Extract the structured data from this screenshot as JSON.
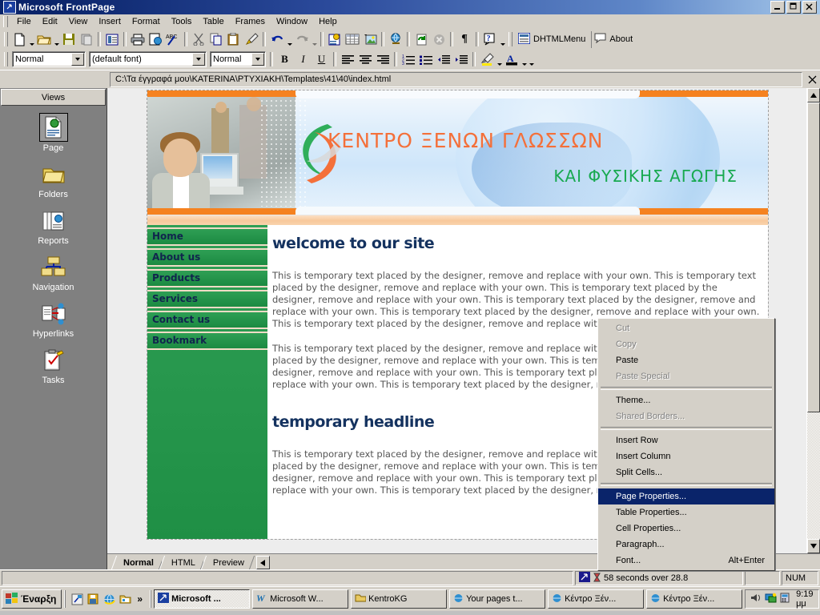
{
  "window": {
    "title": "Microsoft FrontPage",
    "icon": "frontpage-icon",
    "minimize": "_",
    "restore": "❐",
    "close": "✕"
  },
  "menubar": {
    "items": [
      "File",
      "Edit",
      "View",
      "Insert",
      "Format",
      "Tools",
      "Table",
      "Frames",
      "Window",
      "Help"
    ]
  },
  "standard_toolbar": {
    "buttons": [
      {
        "name": "new-page-button",
        "icon": "new-page-icon"
      },
      {
        "name": "open-button",
        "icon": "open-folder-icon"
      },
      {
        "name": "save-button",
        "icon": "save-disk-icon"
      },
      {
        "name": "publish-web-button",
        "icon": "publish-web-icon"
      },
      {
        "name": "folder-list-button",
        "icon": "folder-list-icon"
      },
      {
        "name": "print-button",
        "icon": "printer-icon"
      },
      {
        "name": "print-preview-button",
        "icon": "print-preview-icon"
      },
      {
        "name": "spelling-button",
        "icon": "spelling-abc-icon"
      },
      {
        "name": "cut-button",
        "icon": "scissors-icon"
      },
      {
        "name": "copy-button",
        "icon": "copy-icon"
      },
      {
        "name": "paste-button",
        "icon": "paste-clipboard-icon"
      },
      {
        "name": "format-painter-button",
        "icon": "paintbrush-icon"
      },
      {
        "name": "undo-button",
        "icon": "undo-arrow-icon"
      },
      {
        "name": "redo-button",
        "icon": "redo-arrow-icon"
      },
      {
        "name": "web-component-button",
        "icon": "web-component-icon"
      },
      {
        "name": "insert-table-button",
        "icon": "table-grid-icon"
      },
      {
        "name": "insert-picture-button",
        "icon": "picture-icon"
      },
      {
        "name": "hyperlink-button",
        "icon": "globe-link-icon"
      },
      {
        "name": "refresh-button",
        "icon": "refresh-icon"
      },
      {
        "name": "stop-button",
        "icon": "stop-icon"
      },
      {
        "name": "show-all-button",
        "icon": "pilcrow-icon"
      },
      {
        "name": "help-button",
        "icon": "help-question-icon"
      }
    ],
    "dhtml_menu_label": "DHTMLMenu",
    "about_label": "About"
  },
  "formatting_toolbar": {
    "style_value": "Normal",
    "font_value": "(default font)",
    "size_value": "Normal",
    "bold": "B",
    "italic": "I",
    "underline": "U",
    "buttons": [
      {
        "name": "align-left-button",
        "icon": "align-left-icon"
      },
      {
        "name": "align-center-button",
        "icon": "align-center-icon"
      },
      {
        "name": "align-right-button",
        "icon": "align-right-icon"
      },
      {
        "name": "numbered-list-button",
        "icon": "numbered-list-icon"
      },
      {
        "name": "bulleted-list-button",
        "icon": "bulleted-list-icon"
      },
      {
        "name": "decrease-indent-button",
        "icon": "decrease-indent-icon"
      },
      {
        "name": "increase-indent-button",
        "icon": "increase-indent-icon"
      },
      {
        "name": "highlight-button",
        "icon": "highlighter-icon"
      },
      {
        "name": "font-color-button",
        "icon": "font-color-icon"
      }
    ]
  },
  "address_bar": {
    "path": "C:\\Τα έγγραφά μου\\KATERINA\\PTYXIAKH\\Templates\\41\\40\\index.html",
    "close": "✕"
  },
  "views_pane": {
    "header": "Views",
    "items": [
      {
        "label": "Page",
        "icon": "page-view-icon",
        "selected": true
      },
      {
        "label": "Folders",
        "icon": "folders-view-icon",
        "selected": false
      },
      {
        "label": "Reports",
        "icon": "reports-view-icon",
        "selected": false
      },
      {
        "label": "Navigation",
        "icon": "navigation-view-icon",
        "selected": false
      },
      {
        "label": "Hyperlinks",
        "icon": "hyperlinks-view-icon",
        "selected": false
      },
      {
        "label": "Tasks",
        "icon": "tasks-view-icon",
        "selected": false
      }
    ]
  },
  "page": {
    "banner": {
      "title": "ΚΕΝΤΡΟ ΞΕΝΩΝ ΓΛΩΣΣΩΝ",
      "subtitle": "ΚΑΙ ΦΥΣΙΚΗΣ ΑΓΩΓΗΣ",
      "title_color": "#f4703a",
      "subtitle_color": "#18a950"
    },
    "nav": {
      "items": [
        "Home",
        "About us",
        "Products",
        "Services",
        "Contact us",
        "Bookmark"
      ],
      "bg_color": "#2a9a4f",
      "text_color": "#10254d"
    },
    "headline1": "welcome to our site",
    "headline2": "temporary headline",
    "paragraph1": "This is temporary text placed by the designer, remove and replace with your own. This is temporary text placed by the designer, remove and replace with your own. This is temporary text placed by the designer, remove and replace with your own. This is temporary text placed by the designer, remove and replace with your own. This is temporary text placed by the designer, remove and replace with your own. This is temporary text placed by the designer, remove and replace with your own.",
    "paragraph2": "This is temporary text placed by the designer, remove and replace with your own. This is temporary text placed by the designer, remove and replace with your own. This is temporary text placed by the designer, remove and replace with your own. This is temporary text placed by the designer, remove and replace with your own. This is temporary text placed by the designer, remove and replace with your own.",
    "paragraph3": "This is temporary text placed by the designer, remove and replace with your own. This is temporary text placed by the designer, remove and replace with your own. This is temporary text placed by the designer, remove and replace with your own. This is temporary text placed by the designer, remove and replace with your own. This is temporary text placed by the designer, remove and replace with your own."
  },
  "context_menu": {
    "items": [
      {
        "label": "Cut",
        "state": "disabled",
        "shortcut": ""
      },
      {
        "label": "Copy",
        "state": "disabled",
        "shortcut": ""
      },
      {
        "label": "Paste",
        "state": "normal",
        "shortcut": ""
      },
      {
        "label": "Paste Special",
        "state": "disabled",
        "shortcut": ""
      },
      {
        "separator": true
      },
      {
        "label": "Theme...",
        "state": "normal",
        "shortcut": ""
      },
      {
        "label": "Shared Borders...",
        "state": "disabled",
        "shortcut": ""
      },
      {
        "separator": true
      },
      {
        "label": "Insert Row",
        "state": "normal",
        "shortcut": ""
      },
      {
        "label": "Insert Column",
        "state": "normal",
        "shortcut": ""
      },
      {
        "label": "Split Cells...",
        "state": "normal",
        "shortcut": ""
      },
      {
        "separator": true
      },
      {
        "label": "Page Properties...",
        "state": "selected",
        "shortcut": ""
      },
      {
        "label": "Table Properties...",
        "state": "normal",
        "shortcut": ""
      },
      {
        "label": "Cell Properties...",
        "state": "normal",
        "shortcut": ""
      },
      {
        "label": "Paragraph...",
        "state": "normal",
        "shortcut": ""
      },
      {
        "label": "Font...",
        "state": "normal",
        "shortcut": "Alt+Enter"
      }
    ],
    "highlight_color": "#0a246a"
  },
  "view_tabs": {
    "tabs": [
      "Normal",
      "HTML",
      "Preview"
    ],
    "active": "Normal"
  },
  "status_bar": {
    "estimate": "58 seconds over 28.8",
    "num_lock": "NUM",
    "icon": "frontpage-status-icon",
    "timer_icon": "hourglass-icon"
  },
  "taskbar": {
    "start_label": "Έναρξη",
    "quick_launch": [
      "show-desktop-icon",
      "media-icon",
      "internet-explorer-icon",
      "folder-icon"
    ],
    "overflow": "»",
    "tasks": [
      {
        "label": "Microsoft ...",
        "icon": "frontpage-icon",
        "active": true
      },
      {
        "label": "Microsoft W...",
        "icon": "word-icon",
        "active": false
      },
      {
        "label": "KentroKG",
        "icon": "folder-icon",
        "active": false
      },
      {
        "label": "Your pages t...",
        "icon": "internet-explorer-icon",
        "active": false
      },
      {
        "label": "Κέντρο Ξέν...",
        "icon": "internet-explorer-icon",
        "active": false
      },
      {
        "label": "Κέντρο Ξέν...",
        "icon": "internet-explorer-icon",
        "active": false
      }
    ],
    "tray_icons": [
      "volume-icon",
      "network-icon",
      "calculator-icon"
    ],
    "clock": "9:19 μμ"
  }
}
